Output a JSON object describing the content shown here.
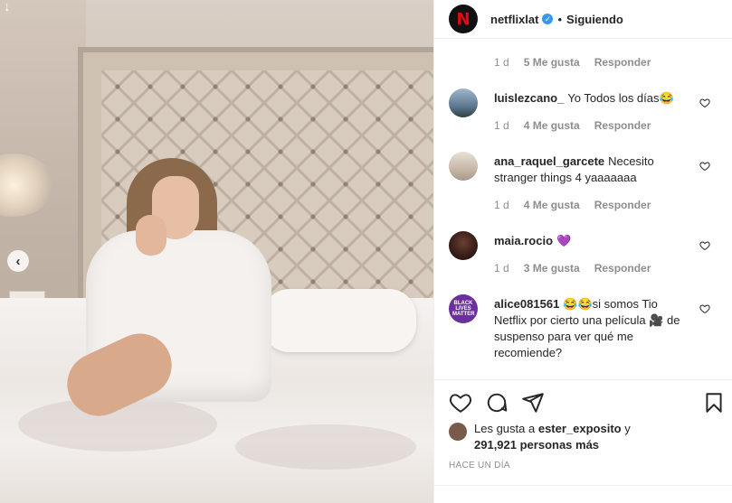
{
  "post": {
    "username": "netflixlat",
    "logo_letter": "N",
    "verified_icon": "verified-badge-icon",
    "separator": "•",
    "follow_status": "Siguiendo"
  },
  "comments": [
    {
      "time": "1 d",
      "likes": "5 Me gusta",
      "reply": "Responder"
    },
    {
      "user": "luislezcano_",
      "text": "Yo Todos los días😂",
      "time": "1 d",
      "likes": "4 Me gusta",
      "reply": "Responder"
    },
    {
      "user": "ana_raquel_garcete",
      "text": "Necesito stranger things 4 yaaaaaaa",
      "time": "1 d",
      "likes": "4 Me gusta",
      "reply": "Responder"
    },
    {
      "user": "maia.rocio",
      "text": "💜",
      "time": "1 d",
      "likes": "3 Me gusta",
      "reply": "Responder"
    },
    {
      "user": "alice081561",
      "text": "😂😂si somos Tio Netflix por cierto una película 🎥 de suspenso para ver qué me recomiende?",
      "avatar_text": "BLACK LIVES MATTER"
    }
  ],
  "likes": {
    "prefix": "Les gusta a",
    "user": "ester_exposito",
    "conj": "y",
    "count": "291,921 personas más"
  },
  "timestamp": "Hace un día",
  "colors": {
    "accent": "#3897f0",
    "netflix_red": "#e50914",
    "muted": "#8e8e8e"
  }
}
